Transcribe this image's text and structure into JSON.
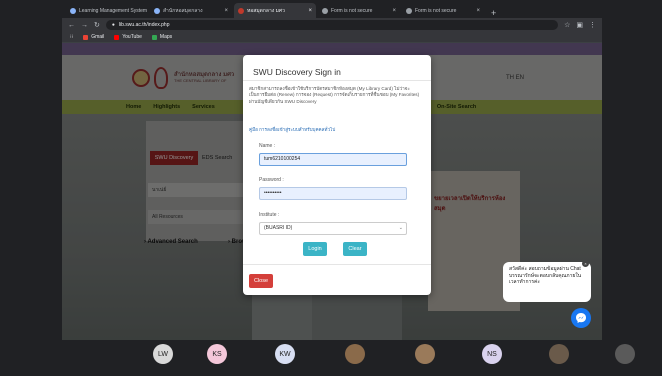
{
  "browser": {
    "tabs": [
      {
        "label": "Learning Management System"
      },
      {
        "label": "สำนักหอสมุดกลาง"
      },
      {
        "label": "หอสมุดกลาง มศว"
      },
      {
        "label": "Form is not secure"
      },
      {
        "label": "Form is not secure"
      }
    ],
    "new_tab": "+",
    "url": "lib.swu.ac.th/index.php",
    "bookmarks": [
      {
        "label": "Gmail",
        "color": "#ea4335"
      },
      {
        "label": "YouTube",
        "color": "#ff0000"
      },
      {
        "label": "Maps",
        "color": "#34a853"
      }
    ]
  },
  "site": {
    "title": "สำนักหอสมุดกลาง มศว",
    "subtitle": "THE CENTRAL LIBRARY OF",
    "lang": "TH  EN",
    "nav": [
      "Home",
      "Highlights",
      "Services",
      "On-Site Search"
    ],
    "search_tab_active": "SWU Discovery",
    "search_tab_other": "EDS Search",
    "search_value": "นาเน่ย์",
    "resources": "All Resources",
    "advanced": "Advanced Search",
    "browse": "Brow",
    "poster_title": "ขยายเวลาเปิดให้บริการห้องสมุด"
  },
  "modal": {
    "title": "SWU Discovery Sign in",
    "description": "สมาชิกสามารถลงชื่อเข้าใช้บริการบัตรสมาชิกห้องสมุด (My Library Card) ไม่ว่าจะเป็นการยืมต่อ (Renew) การจอง (Request) การจัดเก็บรายการที่ชื่นชอบ (My Favorites) ผ่านบัญชีเดียวกัน SWU Discovery",
    "help_link": "คู่มือ การลงชื่อเข้าสู่ระบบสำหรับบุคคลทั่วไป",
    "name_label": "Name :",
    "name_value": "tum6210100254",
    "password_label": "Password :",
    "password_value": "••••••••••",
    "institute_label": "Institute :",
    "institute_value": "(BUASRI ID)",
    "login_label": "Login",
    "clear_label": "Clear",
    "close_label": "Close"
  },
  "chat": {
    "message": "สวัสดีค่ะ สอบถามข้อมูลผ่าน Chat บรรณารักษ์จะตอบกลับคุณภายในเวลาทำการค่ะ",
    "close": "×"
  },
  "participants": [
    {
      "initials": "LW",
      "name": "",
      "color": "#d9d9d9"
    },
    {
      "initials": "KS",
      "name": "",
      "color": "#f4c7d9"
    },
    {
      "initials": "KW",
      "name": "",
      "color": "#d7def2"
    },
    {
      "initials": "",
      "name": "",
      "color": "#8a6a4a"
    },
    {
      "initials": "",
      "name": "",
      "color": "#9a7a5a"
    },
    {
      "initials": "NS",
      "name": "",
      "color": "#d9d2ee"
    },
    {
      "initials": "",
      "name": "",
      "color": "#6a5a4a"
    },
    {
      "initials": "",
      "name": "",
      "color": "#5a5a5a"
    }
  ]
}
